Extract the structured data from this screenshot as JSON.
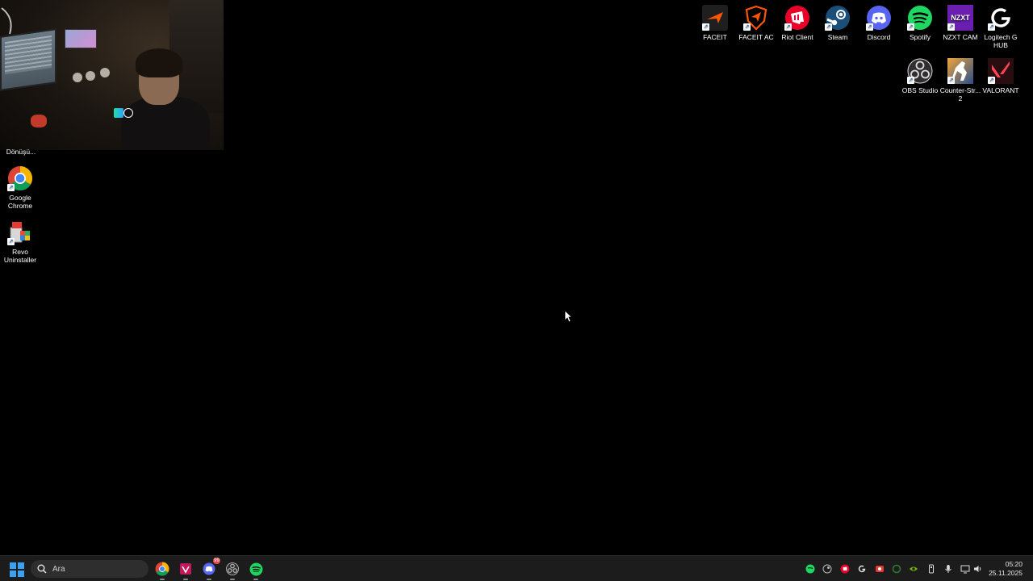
{
  "desktop": {
    "icons_top_right": [
      {
        "label": "FACEIT",
        "icon": "faceit-icon",
        "color": "#ff5500"
      },
      {
        "label": "FACEIT AC",
        "icon": "faceit-ac-icon",
        "color": "#ff5500"
      },
      {
        "label": "Riot Client",
        "icon": "riot-client-icon",
        "color": "#eb0029"
      },
      {
        "label": "Steam",
        "icon": "steam-icon",
        "color": "#1b2838"
      },
      {
        "label": "Discord",
        "icon": "discord-icon",
        "color": "#5865f2"
      },
      {
        "label": "Spotify",
        "icon": "spotify-icon",
        "color": "#1ed760"
      },
      {
        "label": "NZXT CAM",
        "icon": "nzxt-cam-icon",
        "color": "#7a2ab8"
      },
      {
        "label": "Logitech G HUB",
        "icon": "logitech-ghub-icon",
        "color": "#111111"
      }
    ],
    "icons_row2": [
      {
        "label": "OBS Studio",
        "icon": "obs-studio-icon",
        "color": "#302e31"
      },
      {
        "label": "Counter-Str... 2",
        "icon": "counter-strike-2-icon",
        "color": "#de9b35"
      },
      {
        "label": "VALORANT",
        "icon": "valorant-icon",
        "color": "#fd4556"
      }
    ],
    "icons_left": [
      {
        "label": "Google Chrome",
        "icon": "google-chrome-icon"
      },
      {
        "label": "Revo Uninstaller",
        "icon": "revo-uninstaller-icon"
      }
    ],
    "partial_label": "Dönüşü..."
  },
  "taskbar": {
    "search_placeholder": "Ara",
    "apps": [
      {
        "name": "chrome",
        "icon": "google-chrome-icon"
      },
      {
        "name": "antivirus",
        "icon": "shield-app-icon"
      },
      {
        "name": "discord",
        "icon": "discord-icon",
        "badge": "99"
      },
      {
        "name": "obs",
        "icon": "obs-studio-icon"
      },
      {
        "name": "spotify",
        "icon": "spotify-icon"
      }
    ],
    "clock": {
      "time": "05:20",
      "date": "25.11.2025"
    }
  }
}
